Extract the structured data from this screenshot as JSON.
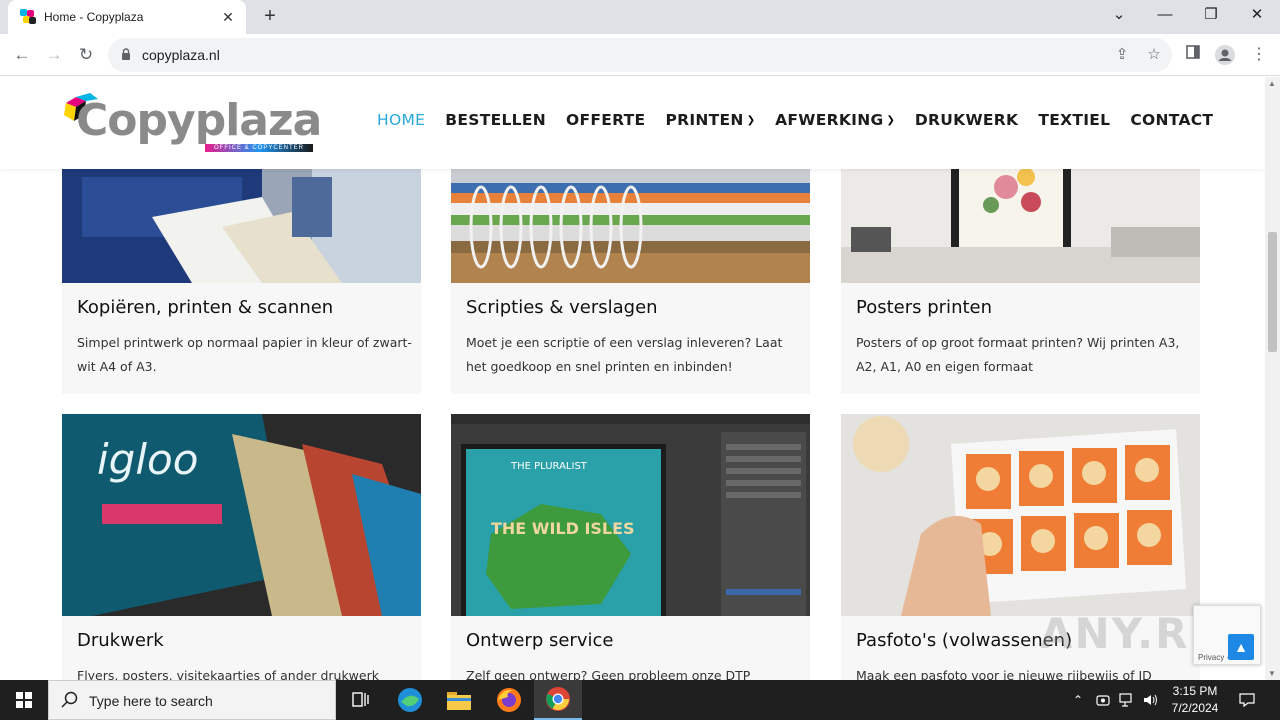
{
  "browser": {
    "tab_title": "Home - Copyplaza",
    "url": "copyplaza.nl"
  },
  "site": {
    "logo_text": "Copyplaza",
    "logo_tagline": "OFFICE & COPYCENTER",
    "nav": [
      {
        "label": "HOME",
        "active": true
      },
      {
        "label": "BESTELLEN"
      },
      {
        "label": "OFFERTE"
      },
      {
        "label": "PRINTEN",
        "dropdown": true
      },
      {
        "label": "AFWERKING",
        "dropdown": true
      },
      {
        "label": "DRUKWERK"
      },
      {
        "label": "TEXTIEL"
      },
      {
        "label": "CONTACT"
      }
    ]
  },
  "cards": [
    {
      "title": "Kopiëren, printen & scannen",
      "text": "Simpel printwerk op normaal papier in kleur of zwart-wit A4 of A3."
    },
    {
      "title": "Scripties & verslagen",
      "text": "Moet je een scriptie of een verslag inleveren? Laat het goedkoop en snel printen en inbinden!"
    },
    {
      "title": "Posters printen",
      "text": "Posters of op groot formaat printen? Wij printen A3, A2, A1, A0 en eigen formaat"
    },
    {
      "title": "Drukwerk",
      "text": "Flyers, posters, visitekaartjes of ander drukwerk"
    },
    {
      "title": "Ontwerp service",
      "text": "Zelf geen ontwerp? Geen probleem onze DTP"
    },
    {
      "title": "Pasfoto's (volwassenen)",
      "text": "Maak een pasfoto voor je nieuwe rijbewijs of ID"
    }
  ],
  "recaptcha": {
    "terms": "Privacy - Terms"
  },
  "watermark": "ANY.RUN",
  "taskbar": {
    "search_placeholder": "Type here to search",
    "time": "3:15 PM",
    "date": "7/2/2024"
  },
  "colors": {
    "accent": "#2aa7d8",
    "card_bg": "#f7f7f7",
    "taskbar": "#1f1f1f"
  }
}
